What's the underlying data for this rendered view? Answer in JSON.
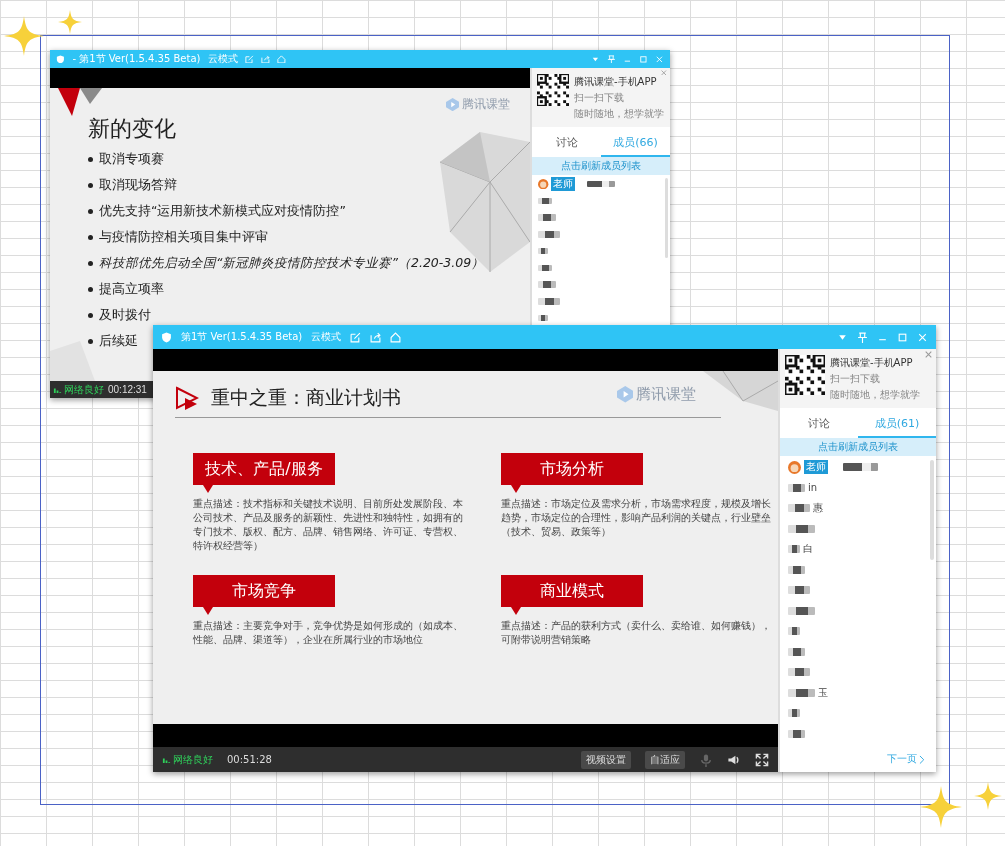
{
  "windows": [
    {
      "kind": "bullets",
      "title": "- 第1节 Ver(1.5.4.35 Beta)",
      "mode": "云模式",
      "slide": {
        "title": "新的变化",
        "watermark": "腾讯课堂",
        "bullets": [
          {
            "text": "取消专项赛",
            "italic": false
          },
          {
            "text": "取消现场答辩",
            "italic": false
          },
          {
            "text": "优先支持“运用新技术新模式应对疫情防控”",
            "italic": false
          },
          {
            "text": "与疫情防控相关项目集中评审",
            "italic": false
          },
          {
            "text": "科技部优先启动全国“新冠肺炎疫情防控技术专业赛”（2.20-3.09）",
            "italic": true
          },
          {
            "text": "提高立项率",
            "italic": false
          },
          {
            "text": "及时拨付",
            "italic": false
          },
          {
            "text": "后续延",
            "italic": false
          }
        ]
      },
      "sidebar": {
        "app_title": "腾讯课堂-手机APP",
        "scan": "扫一扫下载",
        "slogan": "随时随地，想学就学",
        "tabs": [
          {
            "label": "讨论",
            "selected": false
          },
          {
            "label": "成员(66)",
            "selected": true
          }
        ],
        "refresh": "点击刷新成员列表",
        "members": [
          {
            "kind": "teacher",
            "badge": "老师"
          },
          {
            "kind": "blurred"
          },
          {
            "kind": "blurred"
          },
          {
            "kind": "blurred"
          },
          {
            "kind": "blurred"
          },
          {
            "kind": "blurred"
          },
          {
            "kind": "blurred"
          },
          {
            "kind": "blurred"
          },
          {
            "kind": "blurred"
          }
        ]
      },
      "status": {
        "network": "网络良好",
        "time": "00:12:31"
      }
    },
    {
      "kind": "cards",
      "title": "第1节 Ver(1.5.4.35 Beta)",
      "mode": "云模式",
      "slide": {
        "title": "重中之重：商业计划书",
        "watermark": "腾讯课堂",
        "cards": [
          {
            "heading": "技术、产品/服务",
            "description": "重点描述：技术指标和关键技术说明、目前所处发展阶段、本公司技术、产品及服务的新颖性、先进性和独特性，如拥有的专门技术、版权、配方、品牌、销售网络、许可证、专营权、特许权经营等）"
          },
          {
            "heading": "市场分析",
            "description": "重点描述：市场定位及需求分析，市场需求程度，规模及增长趋势，市场定位的合理性，影响产品利润的关键点，行业壁垒（技术、贸易、政策等）"
          },
          {
            "heading": "市场竞争",
            "description": "重点描述：主要竞争对手，竞争优势是如何形成的（如成本、性能、品牌、渠道等），企业在所属行业的市场地位"
          },
          {
            "heading": "商业模式",
            "description": "重点描述：产品的获利方式（卖什么、卖给谁、如何赚钱），可附带说明营销策略"
          }
        ]
      },
      "sidebar": {
        "app_title": "腾讯课堂-手机APP",
        "scan": "扫一扫下载",
        "slogan": "随时随地，想学就学",
        "tabs": [
          {
            "label": "讨论",
            "selected": false
          },
          {
            "label": "成员(61)",
            "selected": true
          }
        ],
        "refresh": "点击刷新成员列表",
        "members": [
          {
            "kind": "teacher",
            "badge": "老师"
          },
          {
            "kind": "blurred",
            "fragment": "in"
          },
          {
            "kind": "blurred",
            "fragment": "惠"
          },
          {
            "kind": "blurred"
          },
          {
            "kind": "blurred",
            "fragment": "白"
          },
          {
            "kind": "blurred"
          },
          {
            "kind": "blurred"
          },
          {
            "kind": "blurred"
          },
          {
            "kind": "blurred"
          },
          {
            "kind": "blurred"
          },
          {
            "kind": "blurred"
          },
          {
            "kind": "blurred",
            "fragment": "玉"
          },
          {
            "kind": "blurred"
          },
          {
            "kind": "blurred"
          }
        ],
        "next_page": "下一页"
      },
      "status": {
        "network": "网络良好",
        "time": "00:51:28",
        "buttons": [
          "视频设置",
          "自适应"
        ]
      }
    }
  ]
}
